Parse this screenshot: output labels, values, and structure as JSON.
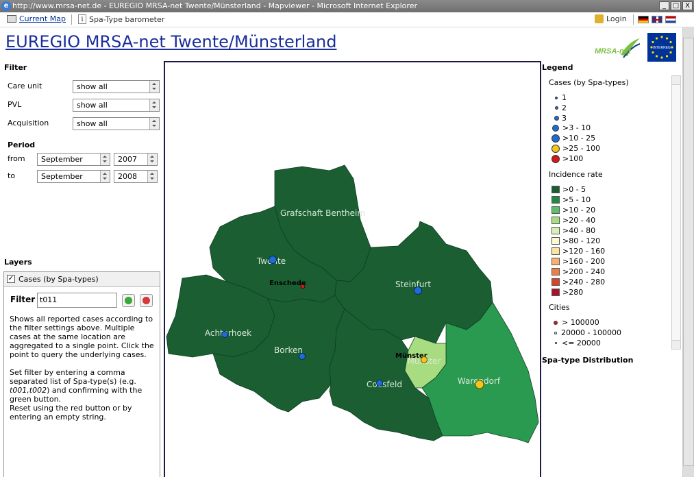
{
  "window": {
    "title": "http://www.mrsa-net.de - EUREGIO MRSA-net Twente/Münsterland - Mapviewer - Microsoft Internet Explorer",
    "btn_min": "_",
    "btn_max": "□",
    "btn_close": "X"
  },
  "toolbar": {
    "current_map": "Current Map",
    "barometer": "Spa-Type barometer",
    "login": "Login"
  },
  "app_title": "EUREGIO MRSA-net Twente/Münsterland",
  "logo_text": "MRSA-net",
  "eu_logo_text": "INTERREG",
  "filter": {
    "heading": "Filter",
    "care_unit_label": "Care unit",
    "care_unit_value": "show all",
    "pvl_label": "PVL",
    "pvl_value": "show all",
    "acquisition_label": "Acquisition",
    "acquisition_value": "show all"
  },
  "period": {
    "heading": "Period",
    "from_label": "from",
    "from_month": "September",
    "from_year": "2007",
    "to_label": "to",
    "to_month": "September",
    "to_year": "2008"
  },
  "layers": {
    "heading": "Layers",
    "layer_name": "Cases (by Spa-types)",
    "checked": "✓",
    "filter_label": "Filter",
    "filter_value": "t011",
    "desc1": "Shows all reported cases according to the filter settings above. Multiple cases at the same location are aggregated to a single point. Click the point to query the underlying cases.",
    "desc2_a": "Set filter by entering a comma separated list of Spa-type(s) (e.g. ",
    "desc2_example": "t001,t002",
    "desc2_b": ") and confirming with the green button.",
    "desc3": "Reset using the red button or by entering an empty string."
  },
  "map": {
    "regions": [
      {
        "name": "Grafschaft Bentheim",
        "color": "#1a5e32"
      },
      {
        "name": "Twente",
        "color": "#1a5e32"
      },
      {
        "name": "Achterhoek",
        "color": "#1a5e32"
      },
      {
        "name": "Borken",
        "color": "#1a5e32"
      },
      {
        "name": "Steinfurt",
        "color": "#1a5e32"
      },
      {
        "name": "Coesfeld",
        "color": "#1a5e32"
      },
      {
        "name": "Warendorf",
        "color": "#2a9a50"
      },
      {
        "name": "Münster",
        "color": "#a8dc80"
      }
    ],
    "cities": [
      "Enschede",
      "Münster"
    ]
  },
  "legend": {
    "heading": "Legend",
    "cases_heading": "Cases (by Spa-types)",
    "cases": [
      {
        "label": "1"
      },
      {
        "label": "2"
      },
      {
        "label": "3"
      },
      {
        "label": ">3 - 10"
      },
      {
        "label": ">10 - 25"
      },
      {
        "label": ">25 - 100"
      },
      {
        "label": ">100"
      }
    ],
    "incidence_heading": "Incidence rate",
    "incidence": [
      {
        "label": ">0 - 5",
        "color": "#1a5e32"
      },
      {
        "label": ">5 - 10",
        "color": "#1f8a44"
      },
      {
        "label": ">10 - 20",
        "color": "#5cc06a"
      },
      {
        "label": ">20 - 40",
        "color": "#a8dc80"
      },
      {
        "label": ">40 - 80",
        "color": "#d8f0b8"
      },
      {
        "label": ">80 - 120",
        "color": "#fafad0"
      },
      {
        "label": ">120 - 160",
        "color": "#fbe3a0"
      },
      {
        "label": ">160 - 200",
        "color": "#f6b070"
      },
      {
        "label": ">200 - 240",
        "color": "#ee7e46"
      },
      {
        "label": ">240 - 280",
        "color": "#d8442a"
      },
      {
        "label": ">280",
        "color": "#a5142a"
      }
    ],
    "cities_heading": "Cities",
    "cities": [
      {
        "label": "> 100000"
      },
      {
        "label": "20000 - 100000"
      },
      {
        "label": "<= 20000"
      }
    ],
    "spa_heading": "Spa-type Distribution"
  }
}
